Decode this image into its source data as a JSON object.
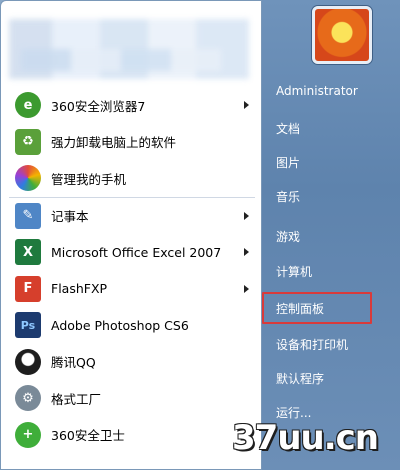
{
  "left_menu": [
    {
      "label": "360安全浏览器7",
      "icon": "browser-360-icon",
      "color": "#3c9a2f",
      "arrow": true
    },
    {
      "label": "强力卸载电脑上的软件",
      "icon": "uninstall-icon",
      "color": "#5aa03a",
      "arrow": false
    },
    {
      "label": "管理我的手机",
      "icon": "phone-manager-icon",
      "color": "#e24b3b",
      "arrow": false
    },
    {
      "label": "记事本",
      "icon": "notepad-icon",
      "color": "#4f86c6",
      "arrow": true
    },
    {
      "label": "Microsoft Office Excel 2007",
      "icon": "excel-icon",
      "color": "#1f7a3e",
      "arrow": true
    },
    {
      "label": "FlashFXP",
      "icon": "flashfxp-icon",
      "color": "#d63f2c",
      "arrow": true
    },
    {
      "label": "Adobe Photoshop CS6",
      "icon": "photoshop-icon",
      "color": "#1d3b6f",
      "arrow": false
    },
    {
      "label": "腾讯QQ",
      "icon": "qq-icon",
      "color": "#1e1e1e",
      "arrow": false
    },
    {
      "label": "格式工厂",
      "icon": "format-factory-icon",
      "color": "#7a8a98",
      "arrow": false
    },
    {
      "label": "360安全卫士",
      "icon": "security-360-icon",
      "color": "#3fae3a",
      "arrow": false
    }
  ],
  "right_menu": [
    {
      "label": "Administrator"
    },
    {
      "label": "文档"
    },
    {
      "label": "图片"
    },
    {
      "label": "音乐"
    },
    {
      "label": "游戏"
    },
    {
      "label": "计算机"
    },
    {
      "label": "控制面板"
    },
    {
      "label": "设备和打印机"
    },
    {
      "label": "默认程序"
    },
    {
      "label": "运行..."
    }
  ],
  "watermark": "37uu.cn",
  "highlight_color": "#d93a3a"
}
